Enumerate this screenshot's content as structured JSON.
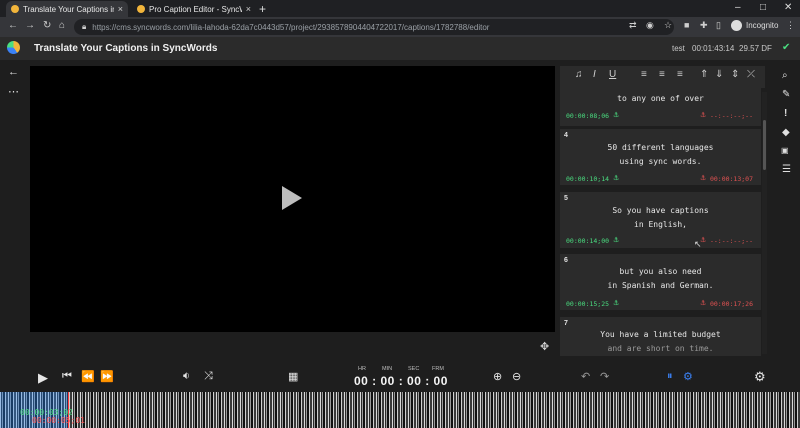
{
  "browser": {
    "tabs": [
      {
        "title": "Translate Your Captions in SyncWo",
        "close": "×"
      },
      {
        "title": "Pro Caption Editor - SyncWords",
        "close": "×"
      }
    ],
    "new_tab": "+",
    "url": "https://cms.syncwords.com/lilia-lahoda-62da7c0443d57/project/2938578904404722017/captions/1782788/editor",
    "profile_label": "Incognito"
  },
  "app": {
    "title": "Translate Your Captions in SyncWords",
    "user": "test",
    "duration": "00:01:43:14",
    "credits": "29.57 DF"
  },
  "captions": [
    {
      "number": "",
      "lines": [
        "to any one of over"
      ],
      "in_time": "00:00:08;06",
      "out_time": "--:--:--;--"
    },
    {
      "number": "4",
      "lines": [
        "50 different languages",
        "using sync words."
      ],
      "in_time": "00:00:10;14",
      "out_time": "00:00:13;07"
    },
    {
      "number": "5",
      "lines": [
        "So you have captions",
        "in English,"
      ],
      "in_time": "00:00:14;00",
      "out_time": "--:--:--;--"
    },
    {
      "number": "6",
      "lines": [
        "but you also need",
        "in Spanish and German."
      ],
      "in_time": "00:00:15;25",
      "out_time": "00:00:17;26"
    },
    {
      "number": "7",
      "lines": [
        "You have a limited budget",
        "and are short on time."
      ],
      "in_time": "",
      "out_time": ""
    }
  ],
  "timecode": {
    "labels": [
      "HR",
      "MIN",
      "SEC",
      "FRM"
    ],
    "value": "00 : 00 : 00 : 00"
  },
  "waveform": {
    "position_in": "00:00:03;02",
    "position_out": "00:00:05;01",
    "selection_color": "#288cff",
    "cursor_color": "#ff3b3b"
  },
  "colors": {
    "in_time": "#4ade80",
    "out_time": "#e05252",
    "accent": "#3b82f6"
  }
}
